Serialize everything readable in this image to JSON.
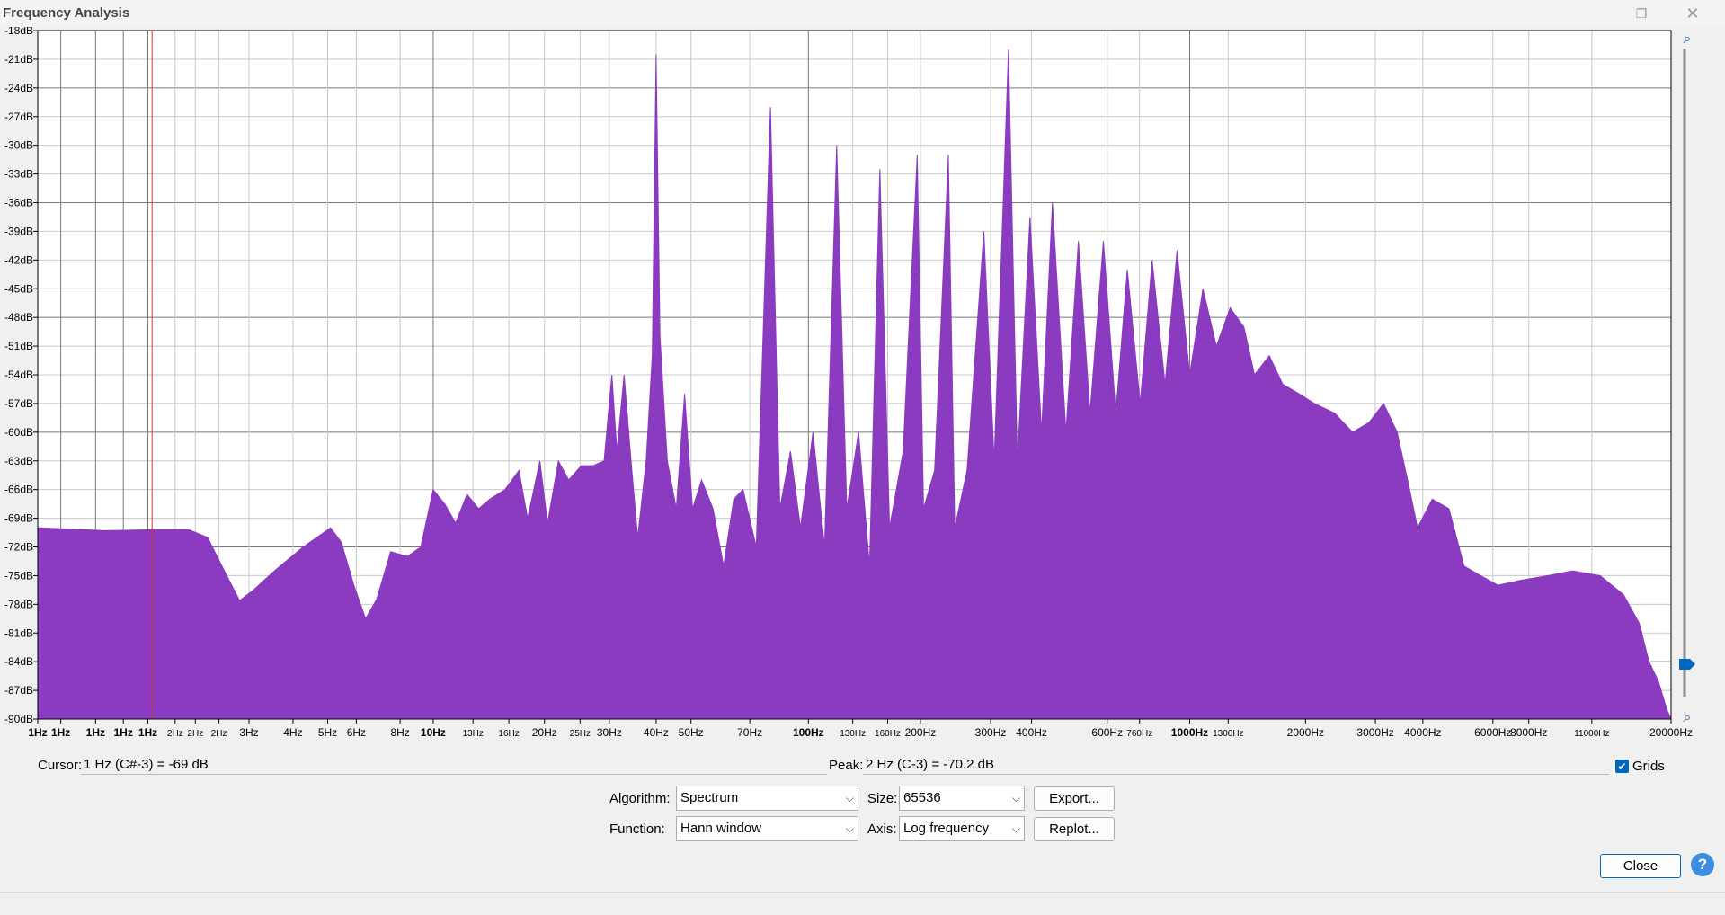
{
  "window": {
    "title": "Frequency Analysis",
    "restore_icon": "restore-icon",
    "close_icon": "close-icon"
  },
  "chart_data": {
    "type": "area",
    "title": "",
    "xlabel": "",
    "ylabel": "",
    "x_scale": "log",
    "xlim": [
      1,
      20000
    ],
    "ylim": [
      -90,
      -18
    ],
    "grid": true,
    "cursor_line_hz": 2,
    "fill_color": "#8a3bc0",
    "cursor_color": "#e03030",
    "y_ticks": [
      "-18dB",
      "-21dB",
      "-24dB",
      "-27dB",
      "-30dB",
      "-33dB",
      "-36dB",
      "-39dB",
      "-42dB",
      "-45dB",
      "-48dB",
      "-51dB",
      "-54dB",
      "-57dB",
      "-60dB",
      "-63dB",
      "-66dB",
      "-69dB",
      "-72dB",
      "-75dB",
      "-78dB",
      "-81dB",
      "-84dB",
      "-87dB",
      "-90dB"
    ],
    "y_tick_values": [
      -18,
      -21,
      -24,
      -27,
      -30,
      -33,
      -36,
      -39,
      -42,
      -45,
      -48,
      -51,
      -54,
      -57,
      -60,
      -63,
      -66,
      -69,
      -72,
      -75,
      -78,
      -81,
      -84,
      -87,
      -90
    ],
    "y_major_values": [
      -24,
      -36,
      -48,
      -60,
      -72,
      -84
    ],
    "x_ticks": [
      {
        "label": "1Hz",
        "v": 1.0
      },
      {
        "label": "1Hz",
        "v": 1.15
      },
      {
        "label": "1Hz",
        "v": 1.42
      },
      {
        "label": "1Hz",
        "v": 1.68
      },
      {
        "label": "1Hz",
        "v": 1.95
      },
      {
        "label": "2Hz",
        "v": 2.3
      },
      {
        "label": "2Hz",
        "v": 2.6
      },
      {
        "label": "2Hz",
        "v": 3.0
      },
      {
        "label": "3Hz",
        "v": 3.6
      },
      {
        "label": "4Hz",
        "v": 4.7
      },
      {
        "label": "5Hz",
        "v": 5.8
      },
      {
        "label": "6Hz",
        "v": 6.9
      },
      {
        "label": "8Hz",
        "v": 9.0
      },
      {
        "label": "10Hz",
        "v": 11.0
      },
      {
        "label": "13Hz",
        "v": 14.0
      },
      {
        "label": "16Hz",
        "v": 17.4
      },
      {
        "label": "20Hz",
        "v": 21.6
      },
      {
        "label": "25Hz",
        "v": 26.8
      },
      {
        "label": "30Hz",
        "v": 32.0
      },
      {
        "label": "40Hz",
        "v": 42.5
      },
      {
        "label": "50Hz",
        "v": 52.5
      },
      {
        "label": "70Hz",
        "v": 75.0
      },
      {
        "label": "100Hz",
        "v": 107.0
      },
      {
        "label": "130Hz",
        "v": 140.0
      },
      {
        "label": "160Hz",
        "v": 173.0
      },
      {
        "label": "200Hz",
        "v": 211.0
      },
      {
        "label": "300Hz",
        "v": 323.0
      },
      {
        "label": "400Hz",
        "v": 414.0
      },
      {
        "label": "600Hz",
        "v": 655.0
      },
      {
        "label": "760Hz",
        "v": 797.0
      },
      {
        "label": "1000Hz",
        "v": 1080.0
      },
      {
        "label": "1300Hz",
        "v": 1364.0
      },
      {
        "label": "2000Hz",
        "v": 2180.0
      },
      {
        "label": "3000Hz",
        "v": 3330.0
      },
      {
        "label": "4000Hz",
        "v": 4440.0
      },
      {
        "label": "6000Hz",
        "v": 6790.0
      },
      {
        "label": "8000Hz",
        "v": 8440.0
      },
      {
        "label": "11000Hz",
        "v": 12370.0
      },
      {
        "label": "20000Hz",
        "v": 20000.0
      }
    ],
    "bold_x_ticks": [
      "1Hz",
      "10Hz",
      "100Hz",
      "1000Hz"
    ],
    "spectrum": [
      [
        1.0,
        -70.0
      ],
      [
        1.5,
        -70.3
      ],
      [
        2.0,
        -70.2
      ],
      [
        2.5,
        -70.2
      ],
      [
        2.8,
        -71.0
      ],
      [
        3.1,
        -74.5
      ],
      [
        3.4,
        -77.6
      ],
      [
        3.7,
        -76.5
      ],
      [
        4.2,
        -74.5
      ],
      [
        5.0,
        -72.0
      ],
      [
        5.9,
        -70.0
      ],
      [
        6.3,
        -71.5
      ],
      [
        6.8,
        -76.0
      ],
      [
        7.3,
        -79.5
      ],
      [
        7.8,
        -77.5
      ],
      [
        8.5,
        -72.5
      ],
      [
        9.4,
        -73.0
      ],
      [
        10.2,
        -72.0
      ],
      [
        11.0,
        -66.0
      ],
      [
        11.8,
        -67.5
      ],
      [
        12.6,
        -69.5
      ],
      [
        13.5,
        -66.5
      ],
      [
        14.5,
        -68.0
      ],
      [
        15.5,
        -67.0
      ],
      [
        17.0,
        -66.0
      ],
      [
        18.5,
        -64.0
      ],
      [
        19.5,
        -69.0
      ],
      [
        21.0,
        -63.0
      ],
      [
        22.0,
        -69.5
      ],
      [
        23.5,
        -63.0
      ],
      [
        25.0,
        -65.0
      ],
      [
        27.0,
        -63.5
      ],
      [
        29.0,
        -63.5
      ],
      [
        31.0,
        -63.0
      ],
      [
        32.5,
        -54.0
      ],
      [
        33.5,
        -62.0
      ],
      [
        35.0,
        -54.0
      ],
      [
        36.5,
        -63.0
      ],
      [
        38.0,
        -71.0
      ],
      [
        40.0,
        -63.0
      ],
      [
        41.5,
        -52.0
      ],
      [
        42.5,
        -20.5
      ],
      [
        43.5,
        -50.0
      ],
      [
        45.5,
        -63.0
      ],
      [
        48.0,
        -68.0
      ],
      [
        50.5,
        -56.0
      ],
      [
        53.0,
        -68.0
      ],
      [
        56.0,
        -65.0
      ],
      [
        60.0,
        -68.0
      ],
      [
        64.0,
        -74.0
      ],
      [
        68.0,
        -67.0
      ],
      [
        72.0,
        -66.0
      ],
      [
        78.0,
        -72.0
      ],
      [
        85.0,
        -26.0
      ],
      [
        90.0,
        -68.0
      ],
      [
        96.0,
        -62.0
      ],
      [
        102.0,
        -70.0
      ],
      [
        110.0,
        -60.0
      ],
      [
        118.0,
        -72.0
      ],
      [
        127.0,
        -30.0
      ],
      [
        135.0,
        -68.0
      ],
      [
        145.0,
        -60.0
      ],
      [
        155.0,
        -74.0
      ],
      [
        165.0,
        -32.5
      ],
      [
        175.0,
        -70.0
      ],
      [
        190.0,
        -62.0
      ],
      [
        207.0,
        -31.0
      ],
      [
        215.0,
        -68.0
      ],
      [
        230.0,
        -64.0
      ],
      [
        250.0,
        -31.0
      ],
      [
        260.0,
        -70.0
      ],
      [
        280.0,
        -64.0
      ],
      [
        310.0,
        -39.0
      ],
      [
        330.0,
        -63.0
      ],
      [
        360.0,
        -20.0
      ],
      [
        380.0,
        -63.0
      ],
      [
        410.0,
        -37.5
      ],
      [
        440.0,
        -60.0
      ],
      [
        470.0,
        -36.0
      ],
      [
        510.0,
        -60.0
      ],
      [
        550.0,
        -40.0
      ],
      [
        590.0,
        -58.0
      ],
      [
        640.0,
        -40.0
      ],
      [
        690.0,
        -58.0
      ],
      [
        740.0,
        -43.0
      ],
      [
        800.0,
        -57.0
      ],
      [
        860.0,
        -42.0
      ],
      [
        930.0,
        -55.0
      ],
      [
        1000.0,
        -41.0
      ],
      [
        1080.0,
        -54.0
      ],
      [
        1170.0,
        -45.0
      ],
      [
        1270.0,
        -51.0
      ],
      [
        1380.0,
        -47.0
      ],
      [
        1500.0,
        -49.0
      ],
      [
        1600.0,
        -54.0
      ],
      [
        1750.0,
        -52.0
      ],
      [
        1900.0,
        -55.0
      ],
      [
        2100.0,
        -56.0
      ],
      [
        2300.0,
        -57.0
      ],
      [
        2600.0,
        -58.0
      ],
      [
        2900.0,
        -60.0
      ],
      [
        3200.0,
        -59.0
      ],
      [
        3500.0,
        -57.0
      ],
      [
        3800.0,
        -60.0
      ],
      [
        4100.0,
        -66.0
      ],
      [
        4300.0,
        -70.0
      ],
      [
        4700.0,
        -67.0
      ],
      [
        5200.0,
        -68.0
      ],
      [
        5700.0,
        -74.0
      ],
      [
        6300.0,
        -75.0
      ],
      [
        7000.0,
        -76.0
      ],
      [
        8000.0,
        -75.5
      ],
      [
        9500.0,
        -75.0
      ],
      [
        11000.0,
        -74.5
      ],
      [
        13000.0,
        -75.0
      ],
      [
        15000.0,
        -77.0
      ],
      [
        16500.0,
        -80.0
      ],
      [
        17500.0,
        -84.0
      ],
      [
        18500.0,
        -86.0
      ],
      [
        19500.0,
        -89.0
      ],
      [
        20000.0,
        -90.0
      ]
    ]
  },
  "zoom_in_icon": "zoom-in-icon",
  "zoom_out_icon": "zoom-out-icon",
  "zoom_slider": {
    "level": 0.05
  },
  "cursor": {
    "label": "Cursor:",
    "value": "1 Hz (C#-3) = -69 dB"
  },
  "peak": {
    "label": "Peak:",
    "value": "2 Hz (C-3) = -70.2 dB"
  },
  "grids": {
    "label": "Grids",
    "checked": true
  },
  "algorithm": {
    "label": "Algorithm:",
    "value": "Spectrum"
  },
  "function": {
    "label": "Function:",
    "value": "Hann window"
  },
  "size": {
    "label": "Size:",
    "value": "65536"
  },
  "axis": {
    "label": "Axis:",
    "value": "Log frequency"
  },
  "buttons": {
    "export": "Export...",
    "replot": "Replot...",
    "close": "Close",
    "help": "?"
  }
}
